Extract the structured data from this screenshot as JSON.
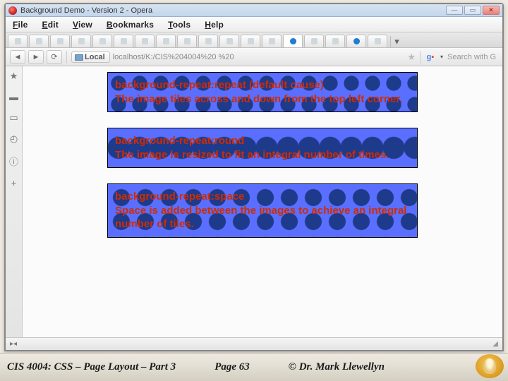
{
  "window": {
    "title": "Background Demo - Version 2 - Opera"
  },
  "menu": {
    "file": "File",
    "edit": "Edit",
    "view": "View",
    "bookmarks": "Bookmarks",
    "tools": "Tools",
    "help": "Help"
  },
  "nav": {
    "local_label": "Local",
    "url": "localhost/K:/CIS%204004%20",
    "url_suffix": "%20",
    "search_hint": "Search with G"
  },
  "boxes": {
    "repeat": "background-repeat:repeat (default cause)\nThe image tiles across and down from the top left corner.",
    "round": "background-repeat:round\nThe image is resized to fit an integral number of times.",
    "space": "background-repeat:space\nSpace is added between the images to achieve an integral number of tiles."
  },
  "footer": {
    "left": "CIS 4004: CSS – Page Layout – Part 3",
    "mid": "Page 63",
    "right": "© Dr. Mark Llewellyn"
  }
}
